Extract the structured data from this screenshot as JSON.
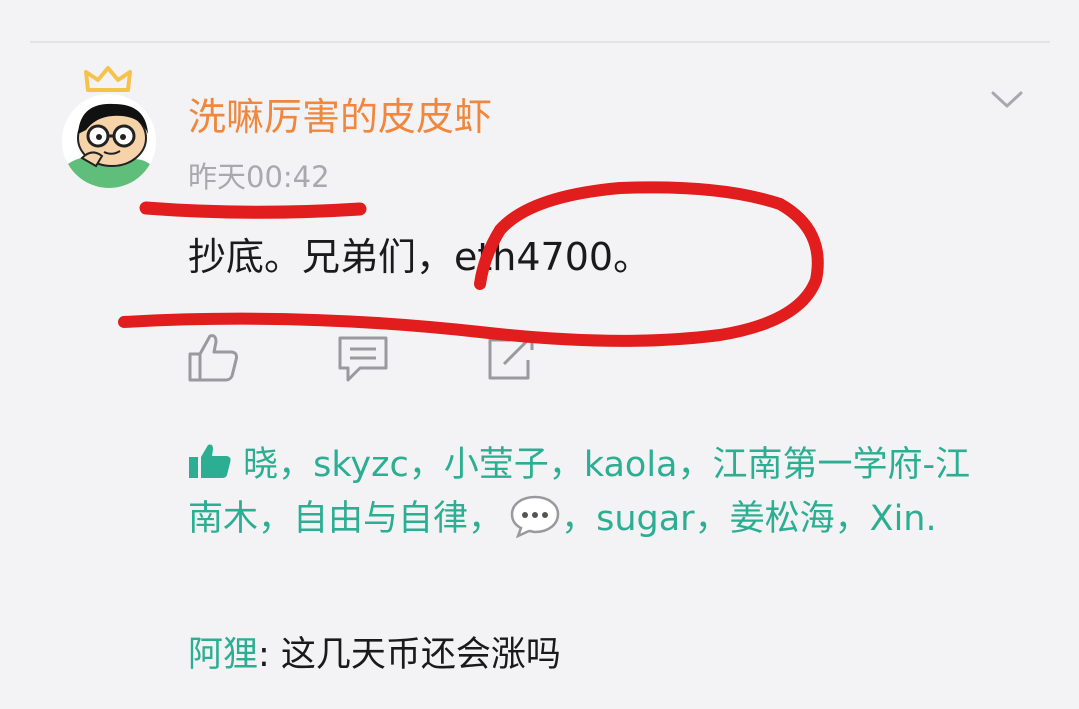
{
  "post": {
    "username": "洗嘛厉害的皮皮虾",
    "timestamp": "昨天00:42",
    "text": "抄底。兄弟们，eth4700。"
  },
  "likes": {
    "names": [
      "晓",
      "skyzc",
      "小莹子",
      "kaola",
      "江南第一学府-江南木",
      "自由与自律"
    ],
    "names_after_emoji": [
      "sugar",
      "姜松海",
      "Xin."
    ]
  },
  "reply": {
    "user": "阿狸",
    "text": ": 这几天币还会涨吗"
  },
  "colors": {
    "username": "#f0873d",
    "timestamp": "#a9a9ad",
    "link": "#2cae92",
    "annotation": "#e11d1d",
    "crown": "#f5c24b"
  },
  "icons": {
    "crown": "crown-icon",
    "chevron": "chevron-down-icon",
    "like": "thumbs-up-icon",
    "comment": "comment-icon",
    "share": "share-icon",
    "likes_marker": "thumbs-up-filled-icon",
    "emoji_user": "speech-bubble-emoji-icon"
  }
}
